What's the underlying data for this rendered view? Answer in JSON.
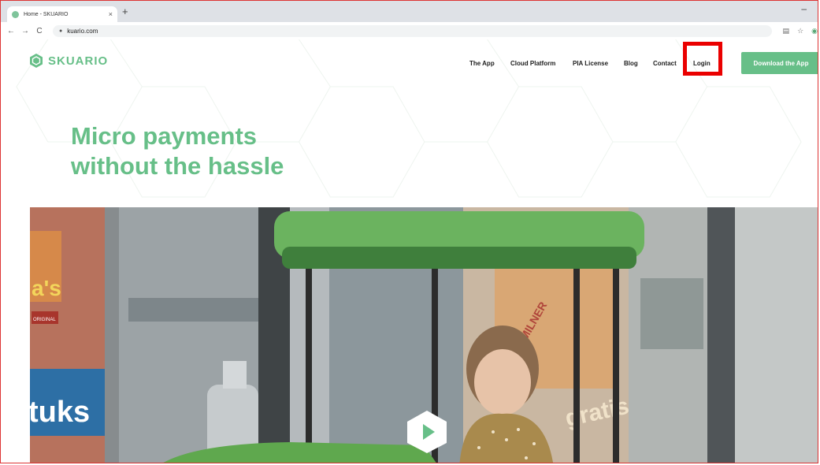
{
  "browser": {
    "tab_title": "Home - SKUARIO",
    "tab_close": "×",
    "new_tab": "+",
    "minimize": "–",
    "back": "←",
    "forward": "→",
    "reload": "C",
    "url": "kuario.com"
  },
  "site": {
    "logo_text": "SKUARIO",
    "nav": {
      "the_app": "The App",
      "cloud_platform": "Cloud Platform",
      "pia_license": "PIA License",
      "blog": "Blog",
      "contact": "Contact",
      "login": "Login"
    },
    "download_label": "Download the App",
    "headline_line1": "Micro payments",
    "headline_line2": "without the hassle",
    "hero_signs": {
      "left_brand": "a's",
      "left_badge": "ORIGINAL",
      "left_word": "tuks",
      "right_brand": "MILNER",
      "right_word": "gratis"
    }
  },
  "colors": {
    "brand_green": "#67bf88",
    "highlight_red": "#ea0000"
  },
  "icons": [
    "site-favicon",
    "lock-icon",
    "translate-icon",
    "star-icon",
    "extension-icon",
    "skuario-logo-icon",
    "play-icon"
  ]
}
